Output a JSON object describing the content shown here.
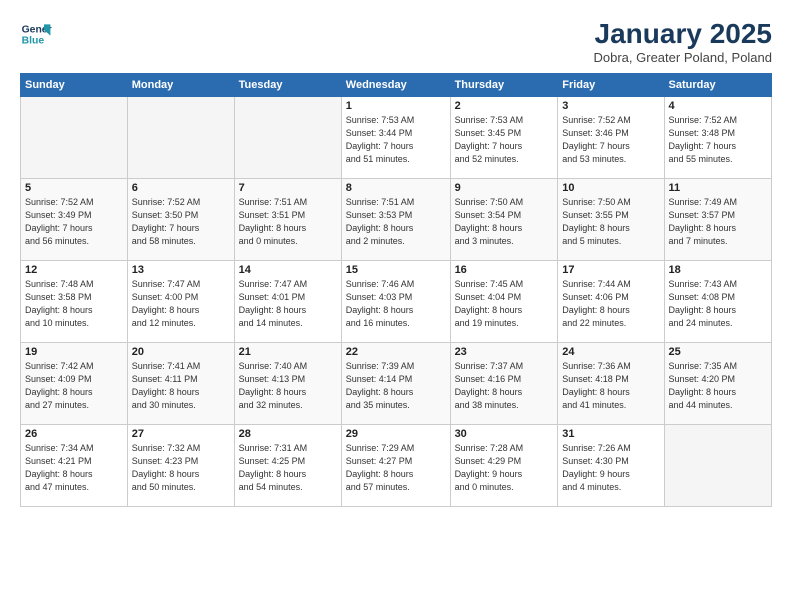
{
  "logo": {
    "line1": "General",
    "line2": "Blue"
  },
  "title": "January 2025",
  "subtitle": "Dobra, Greater Poland, Poland",
  "days_header": [
    "Sunday",
    "Monday",
    "Tuesday",
    "Wednesday",
    "Thursday",
    "Friday",
    "Saturday"
  ],
  "weeks": [
    [
      {
        "day": "",
        "info": ""
      },
      {
        "day": "",
        "info": ""
      },
      {
        "day": "",
        "info": ""
      },
      {
        "day": "1",
        "info": "Sunrise: 7:53 AM\nSunset: 3:44 PM\nDaylight: 7 hours\nand 51 minutes."
      },
      {
        "day": "2",
        "info": "Sunrise: 7:53 AM\nSunset: 3:45 PM\nDaylight: 7 hours\nand 52 minutes."
      },
      {
        "day": "3",
        "info": "Sunrise: 7:52 AM\nSunset: 3:46 PM\nDaylight: 7 hours\nand 53 minutes."
      },
      {
        "day": "4",
        "info": "Sunrise: 7:52 AM\nSunset: 3:48 PM\nDaylight: 7 hours\nand 55 minutes."
      }
    ],
    [
      {
        "day": "5",
        "info": "Sunrise: 7:52 AM\nSunset: 3:49 PM\nDaylight: 7 hours\nand 56 minutes."
      },
      {
        "day": "6",
        "info": "Sunrise: 7:52 AM\nSunset: 3:50 PM\nDaylight: 7 hours\nand 58 minutes."
      },
      {
        "day": "7",
        "info": "Sunrise: 7:51 AM\nSunset: 3:51 PM\nDaylight: 8 hours\nand 0 minutes."
      },
      {
        "day": "8",
        "info": "Sunrise: 7:51 AM\nSunset: 3:53 PM\nDaylight: 8 hours\nand 2 minutes."
      },
      {
        "day": "9",
        "info": "Sunrise: 7:50 AM\nSunset: 3:54 PM\nDaylight: 8 hours\nand 3 minutes."
      },
      {
        "day": "10",
        "info": "Sunrise: 7:50 AM\nSunset: 3:55 PM\nDaylight: 8 hours\nand 5 minutes."
      },
      {
        "day": "11",
        "info": "Sunrise: 7:49 AM\nSunset: 3:57 PM\nDaylight: 8 hours\nand 7 minutes."
      }
    ],
    [
      {
        "day": "12",
        "info": "Sunrise: 7:48 AM\nSunset: 3:58 PM\nDaylight: 8 hours\nand 10 minutes."
      },
      {
        "day": "13",
        "info": "Sunrise: 7:47 AM\nSunset: 4:00 PM\nDaylight: 8 hours\nand 12 minutes."
      },
      {
        "day": "14",
        "info": "Sunrise: 7:47 AM\nSunset: 4:01 PM\nDaylight: 8 hours\nand 14 minutes."
      },
      {
        "day": "15",
        "info": "Sunrise: 7:46 AM\nSunset: 4:03 PM\nDaylight: 8 hours\nand 16 minutes."
      },
      {
        "day": "16",
        "info": "Sunrise: 7:45 AM\nSunset: 4:04 PM\nDaylight: 8 hours\nand 19 minutes."
      },
      {
        "day": "17",
        "info": "Sunrise: 7:44 AM\nSunset: 4:06 PM\nDaylight: 8 hours\nand 22 minutes."
      },
      {
        "day": "18",
        "info": "Sunrise: 7:43 AM\nSunset: 4:08 PM\nDaylight: 8 hours\nand 24 minutes."
      }
    ],
    [
      {
        "day": "19",
        "info": "Sunrise: 7:42 AM\nSunset: 4:09 PM\nDaylight: 8 hours\nand 27 minutes."
      },
      {
        "day": "20",
        "info": "Sunrise: 7:41 AM\nSunset: 4:11 PM\nDaylight: 8 hours\nand 30 minutes."
      },
      {
        "day": "21",
        "info": "Sunrise: 7:40 AM\nSunset: 4:13 PM\nDaylight: 8 hours\nand 32 minutes."
      },
      {
        "day": "22",
        "info": "Sunrise: 7:39 AM\nSunset: 4:14 PM\nDaylight: 8 hours\nand 35 minutes."
      },
      {
        "day": "23",
        "info": "Sunrise: 7:37 AM\nSunset: 4:16 PM\nDaylight: 8 hours\nand 38 minutes."
      },
      {
        "day": "24",
        "info": "Sunrise: 7:36 AM\nSunset: 4:18 PM\nDaylight: 8 hours\nand 41 minutes."
      },
      {
        "day": "25",
        "info": "Sunrise: 7:35 AM\nSunset: 4:20 PM\nDaylight: 8 hours\nand 44 minutes."
      }
    ],
    [
      {
        "day": "26",
        "info": "Sunrise: 7:34 AM\nSunset: 4:21 PM\nDaylight: 8 hours\nand 47 minutes."
      },
      {
        "day": "27",
        "info": "Sunrise: 7:32 AM\nSunset: 4:23 PM\nDaylight: 8 hours\nand 50 minutes."
      },
      {
        "day": "28",
        "info": "Sunrise: 7:31 AM\nSunset: 4:25 PM\nDaylight: 8 hours\nand 54 minutes."
      },
      {
        "day": "29",
        "info": "Sunrise: 7:29 AM\nSunset: 4:27 PM\nDaylight: 8 hours\nand 57 minutes."
      },
      {
        "day": "30",
        "info": "Sunrise: 7:28 AM\nSunset: 4:29 PM\nDaylight: 9 hours\nand 0 minutes."
      },
      {
        "day": "31",
        "info": "Sunrise: 7:26 AM\nSunset: 4:30 PM\nDaylight: 9 hours\nand 4 minutes."
      },
      {
        "day": "",
        "info": ""
      }
    ]
  ]
}
